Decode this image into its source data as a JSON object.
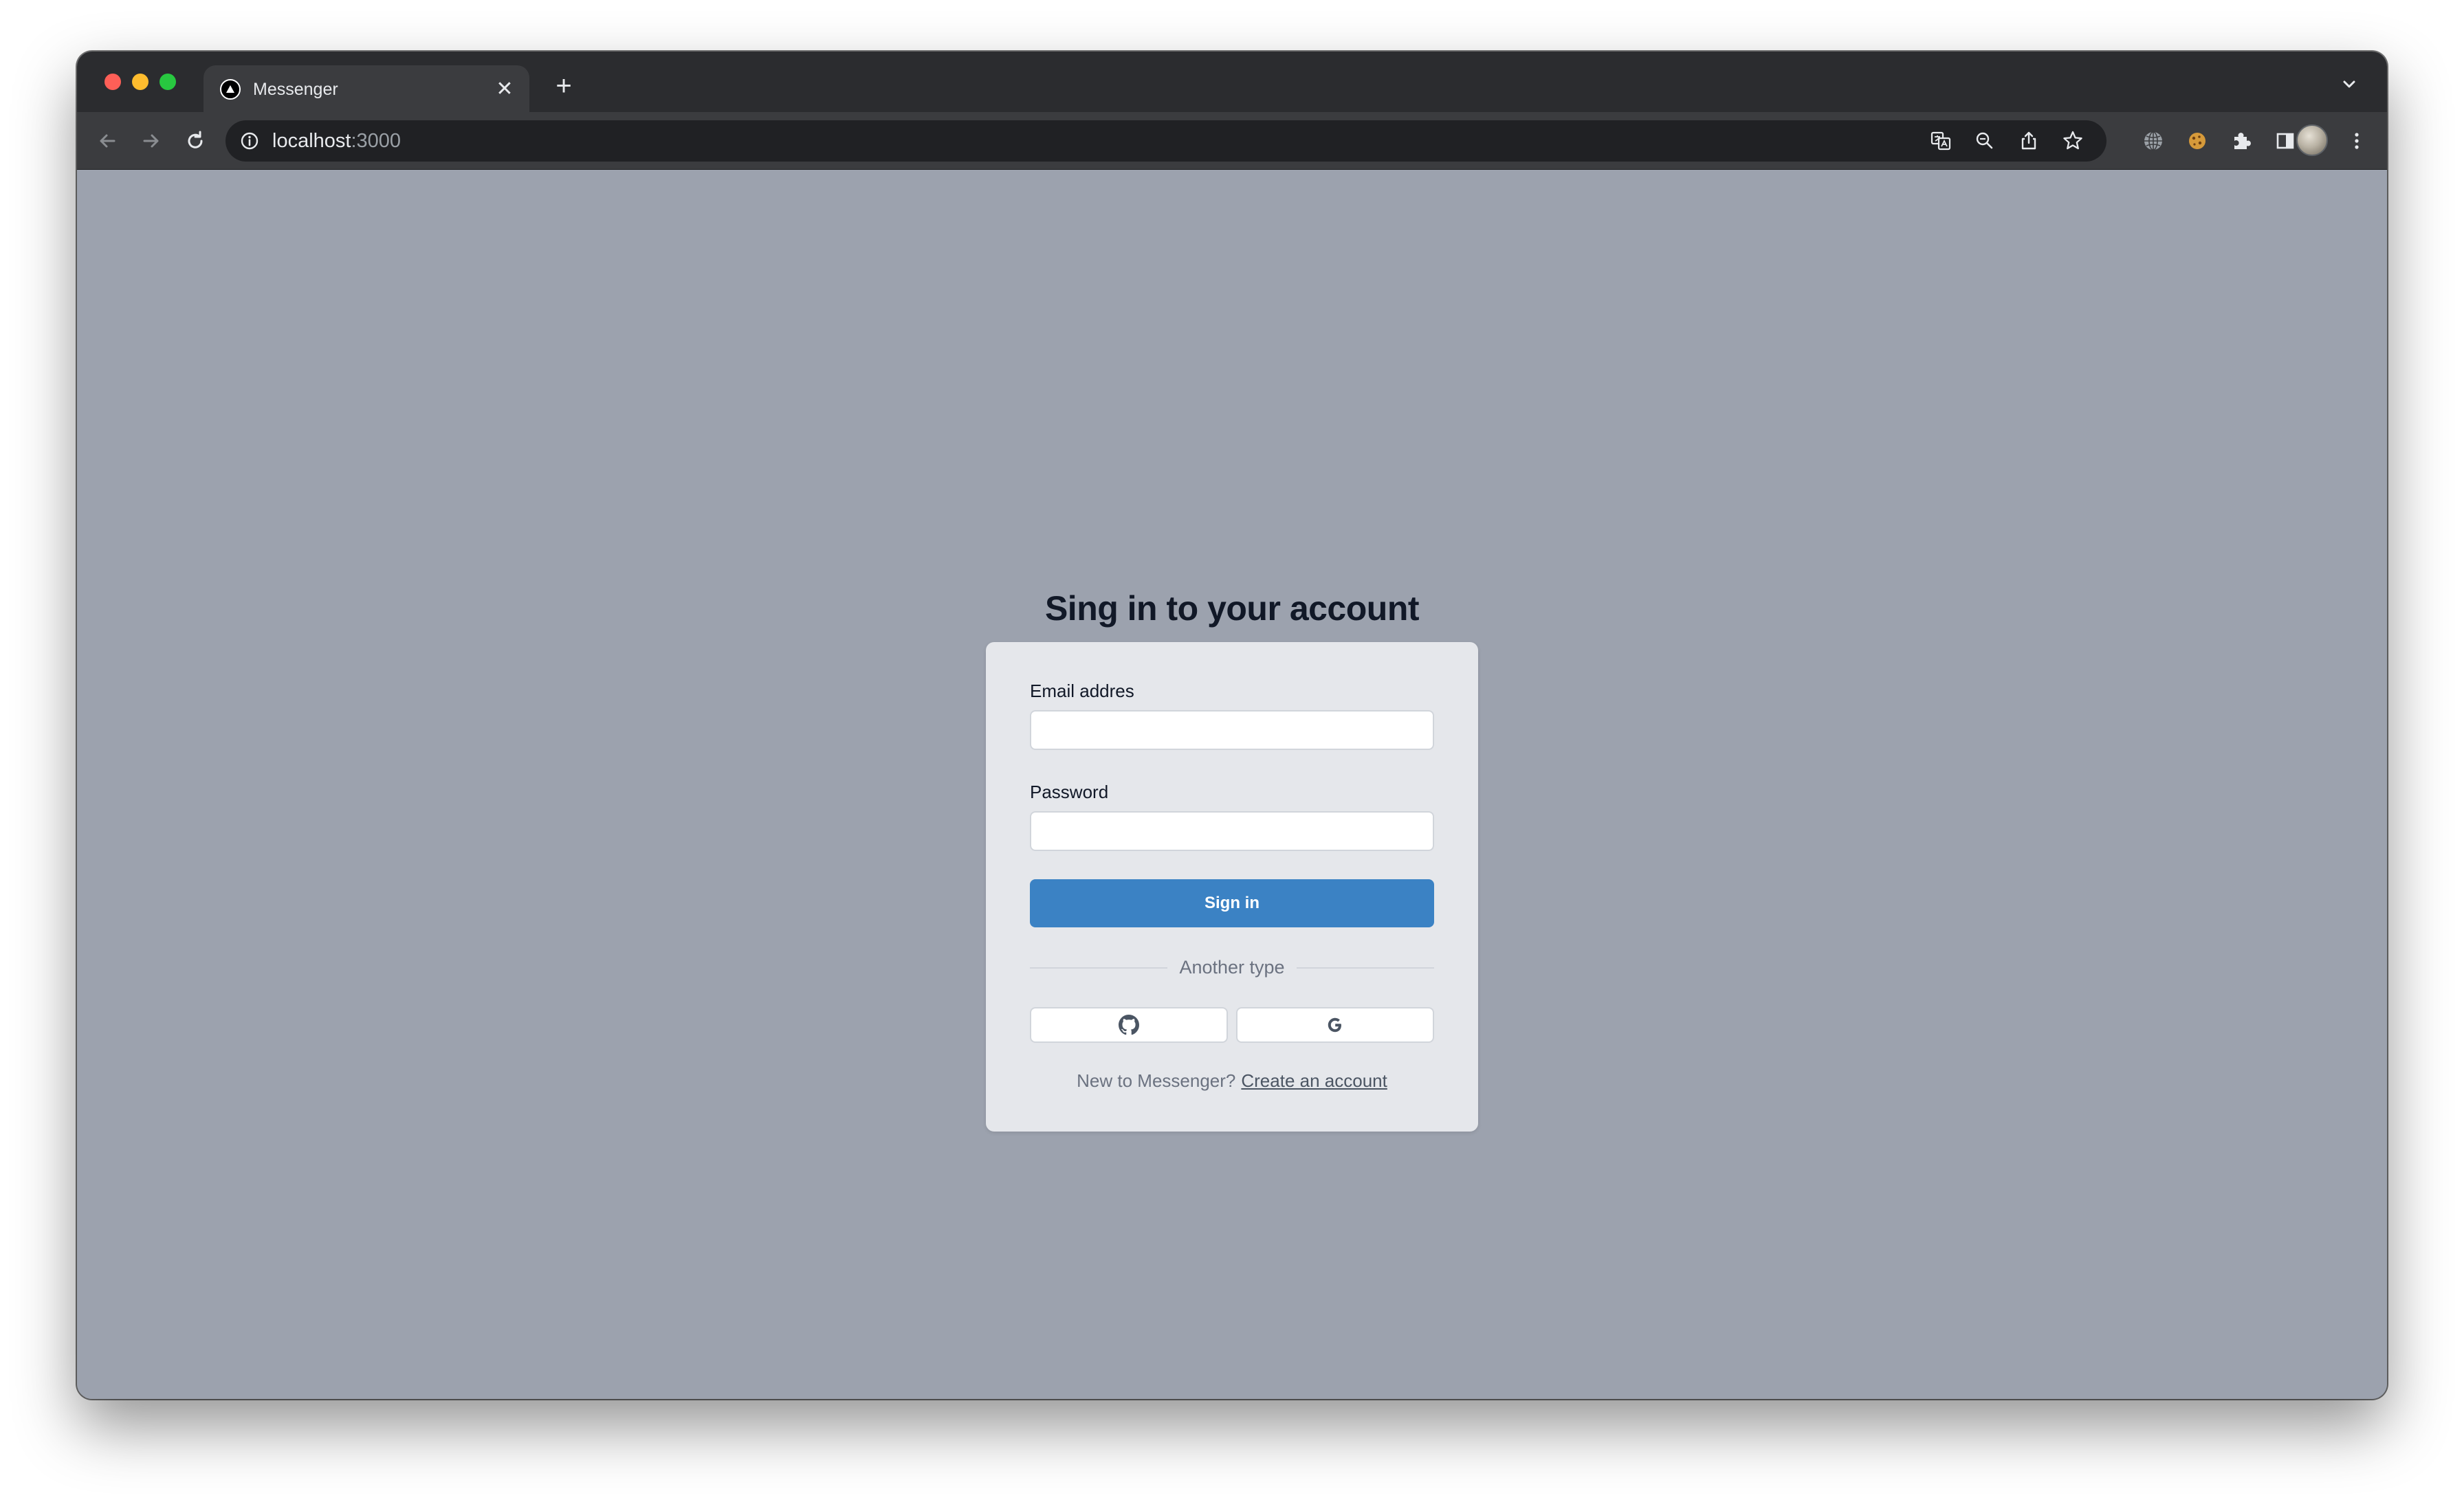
{
  "browser": {
    "tab_title": "Messenger",
    "tab_close": "✕",
    "new_tab": "+",
    "url_host": "localhost",
    "url_port": ":3000"
  },
  "page": {
    "heading": "Sing in to your account",
    "email_label": "Email addres",
    "email_value": "",
    "password_label": "Password",
    "password_value": "",
    "sign_in_label": "Sign in",
    "divider_text": "Another type",
    "footer_prompt": "New to Messenger?",
    "footer_link": "Create an account"
  },
  "colors": {
    "page_background": "#9ca2ae",
    "card_background": "#e5e7eb",
    "primary_button": "#3b82c4",
    "browser_chrome": "#3b3c3f"
  },
  "icons": {
    "social_left": "github-icon",
    "social_right": "google-icon"
  }
}
